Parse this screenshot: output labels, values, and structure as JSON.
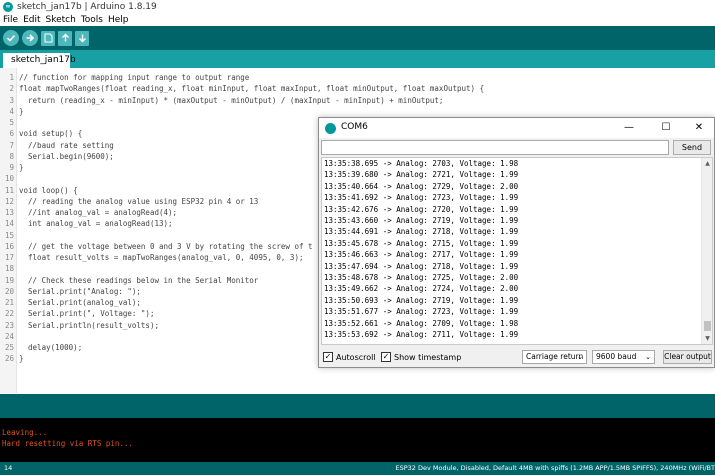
{
  "window": {
    "title": "sketch_jan17b | Arduino 1.8.19"
  },
  "menu": [
    "File",
    "Edit",
    "Sketch",
    "Tools",
    "Help"
  ],
  "tabs": [
    {
      "label": "sketch_jan17b"
    }
  ],
  "editor": {
    "lines": [
      {
        "n": "1",
        "text": "// function for mapping input range to output range"
      },
      {
        "n": "2",
        "text": "float mapTwoRanges(float reading_x, float minInput, float maxInput, float minOutput, float maxOutput) {"
      },
      {
        "n": "3",
        "text": "  return (reading_x - minInput) * (maxOutput - minOutput) / (maxInput - minInput) + minOutput;"
      },
      {
        "n": "4",
        "text": "}"
      },
      {
        "n": "5",
        "text": ""
      },
      {
        "n": "6",
        "text": "void setup() {"
      },
      {
        "n": "7",
        "text": "  //baud rate setting"
      },
      {
        "n": "8",
        "text": "  Serial.begin(9600);"
      },
      {
        "n": "9",
        "text": "}"
      },
      {
        "n": "10",
        "text": ""
      },
      {
        "n": "11",
        "text": "void loop() {"
      },
      {
        "n": "12",
        "text": "  // reading the analog value using ESP32 pin 4 or 13"
      },
      {
        "n": "13",
        "text": "  //int analog_val = analogRead(4);"
      },
      {
        "n": "14",
        "text": "  int analog_val = analogRead(13);"
      },
      {
        "n": "15",
        "text": ""
      },
      {
        "n": "16",
        "text": "  // get the voltage between 0 and 3 V by rotating the screw of t"
      },
      {
        "n": "17",
        "text": "  float result_volts = mapTwoRanges(analog_val, 0, 4095, 0, 3);"
      },
      {
        "n": "18",
        "text": ""
      },
      {
        "n": "19",
        "text": "  // Check these readings below in the Serial Monitor"
      },
      {
        "n": "20",
        "text": "  Serial.print(\"Analog: \");"
      },
      {
        "n": "21",
        "text": "  Serial.print(analog_val);"
      },
      {
        "n": "22",
        "text": "  Serial.print(\", Voltage: \");"
      },
      {
        "n": "23",
        "text": "  Serial.println(result_volts);"
      },
      {
        "n": "24",
        "text": ""
      },
      {
        "n": "25",
        "text": "  delay(1000);"
      },
      {
        "n": "26",
        "text": "}"
      }
    ]
  },
  "console": {
    "lines": [
      "Leaving...",
      "Hard resetting via RTS pin..."
    ]
  },
  "statusbar": {
    "line": "14",
    "board": "ESP32 Dev Module, Disabled, Default 4MB with spiffs (1.2MB APP/1.5MB SPIFFS), 240MHz (WiFi/BT"
  },
  "serial_monitor": {
    "title": "COM6",
    "send_label": "Send",
    "input_value": "",
    "output": [
      "13:35:38.695 -> Analog: 2703, Voltage: 1.98",
      "13:35:39.680 -> Analog: 2721, Voltage: 1.99",
      "13:35:40.664 -> Analog: 2729, Voltage: 2.00",
      "13:35:41.692 -> Analog: 2723, Voltage: 1.99",
      "13:35:42.676 -> Analog: 2720, Voltage: 1.99",
      "13:35:43.660 -> Analog: 2719, Voltage: 1.99",
      "13:35:44.691 -> Analog: 2718, Voltage: 1.99",
      "13:35:45.678 -> Analog: 2715, Voltage: 1.99",
      "13:35:46.663 -> Analog: 2717, Voltage: 1.99",
      "13:35:47.694 -> Analog: 2718, Voltage: 1.99",
      "13:35:48.678 -> Analog: 2725, Voltage: 2.00",
      "13:35:49.662 -> Analog: 2724, Voltage: 2.00",
      "13:35:50.693 -> Analog: 2719, Voltage: 1.99",
      "13:35:51.677 -> Analog: 2723, Voltage: 1.99",
      "13:35:52.661 -> Analog: 2709, Voltage: 1.98",
      "13:35:53.692 -> Analog: 2711, Voltage: 1.99"
    ],
    "autoscroll_label": "Autoscroll",
    "autoscroll_checked": true,
    "timestamp_label": "Show timestamp",
    "timestamp_checked": true,
    "line_ending": "Carriage return",
    "baud": "9600 baud",
    "clear_label": "Clear output"
  },
  "colors": {
    "toolbar": "#006468",
    "tabbar": "#17a1a5",
    "console_text": "#e0531c"
  }
}
